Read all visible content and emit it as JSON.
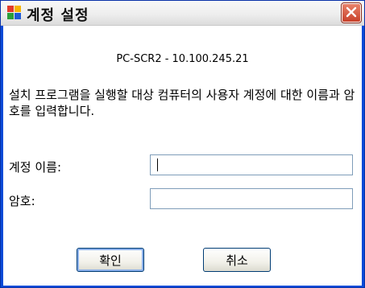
{
  "window": {
    "title": "계정 설정",
    "close_icon": "close-icon"
  },
  "dialog": {
    "host": "PC-SCR2 - 10.100.245.21",
    "description": "설치 프로그램을 실행할 대상 컴퓨터의 사용자 계정에 대한 이름과 암호를 입력합니다.",
    "username_label": "계정 이름:",
    "username_value": "",
    "password_label": "암호:",
    "password_value": "",
    "ok_label": "확인",
    "cancel_label": "취소"
  }
}
